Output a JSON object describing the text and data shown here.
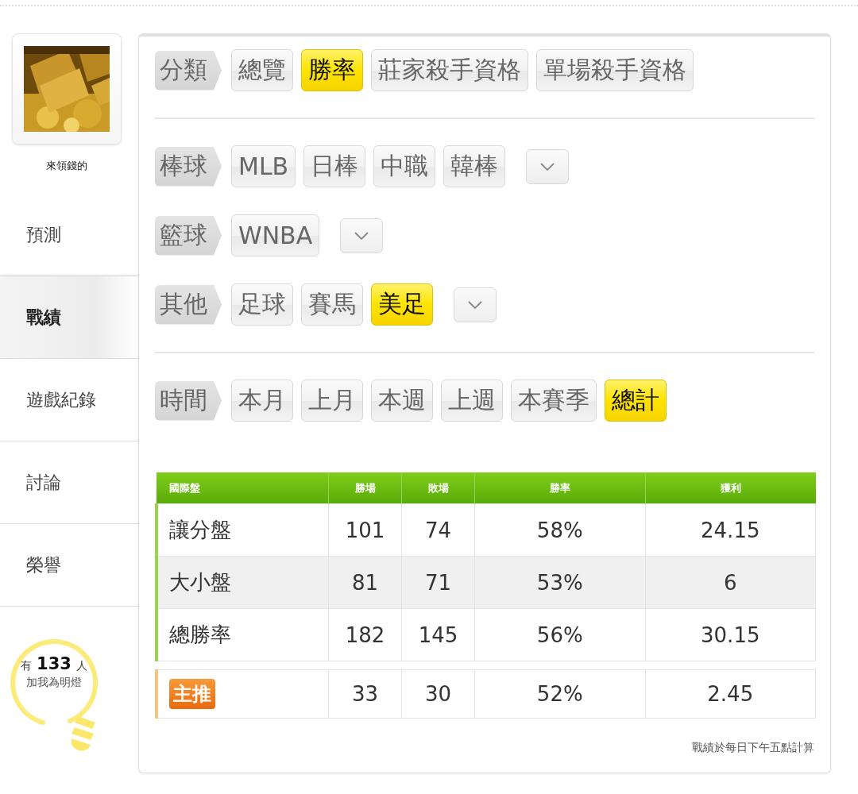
{
  "profile": {
    "kind": "picture",
    "name": "來領錢的"
  },
  "nav": [
    {
      "label": "預測",
      "selected": false
    },
    {
      "label": "戰績",
      "selected": true
    },
    {
      "label": "遊戲紀錄",
      "selected": false
    },
    {
      "label": "討論",
      "selected": false
    },
    {
      "label": "榮譽",
      "selected": false
    }
  ],
  "fans": {
    "prefix": "有",
    "count": "133",
    "suffix": "人",
    "caption": "加我為明燈"
  },
  "filter_sections": [
    [
      {
        "label": "分類",
        "more": false,
        "options": [
          {
            "label": "總覽",
            "selected": false
          },
          {
            "label": "勝率",
            "selected": true
          },
          {
            "label": "莊家殺手資格",
            "selected": false
          },
          {
            "label": "單場殺手資格",
            "selected": false
          }
        ]
      }
    ],
    [
      {
        "label": "棒球",
        "more": true,
        "options": [
          {
            "label": "MLB",
            "selected": false
          },
          {
            "label": "日棒",
            "selected": false
          },
          {
            "label": "中職",
            "selected": false
          },
          {
            "label": "韓棒",
            "selected": false
          }
        ]
      },
      {
        "label": "籃球",
        "more": true,
        "options": [
          {
            "label": "WNBA",
            "selected": false
          }
        ]
      },
      {
        "label": "其他",
        "more": true,
        "options": [
          {
            "label": "足球",
            "selected": false
          },
          {
            "label": "賽馬",
            "selected": false
          },
          {
            "label": "美足",
            "selected": true
          }
        ]
      }
    ],
    [
      {
        "label": "時間",
        "more": false,
        "options": [
          {
            "label": "本月",
            "selected": false
          },
          {
            "label": "上月",
            "selected": false
          },
          {
            "label": "本週",
            "selected": false
          },
          {
            "label": "上週",
            "selected": false
          },
          {
            "label": "本賽季",
            "selected": false
          },
          {
            "label": "總計",
            "selected": true
          }
        ]
      }
    ]
  ],
  "table": {
    "columns": [
      "國際盤",
      "勝場",
      "敗場",
      "勝率",
      "獲利"
    ],
    "rows": [
      {
        "kind": "normal",
        "cells": [
          "讓分盤",
          "101",
          "74",
          "58%",
          "24.15"
        ]
      },
      {
        "kind": "normal",
        "cells": [
          "大小盤",
          "81",
          "71",
          "53%",
          "6"
        ]
      },
      {
        "kind": "normal",
        "cells": [
          "總勝率",
          "182",
          "145",
          "56%",
          "30.15"
        ]
      },
      {
        "kind": "featured",
        "cells": [
          "主推",
          "33",
          "30",
          "52%",
          "2.45"
        ]
      }
    ]
  },
  "note": "戰績於每日下午五點計算"
}
